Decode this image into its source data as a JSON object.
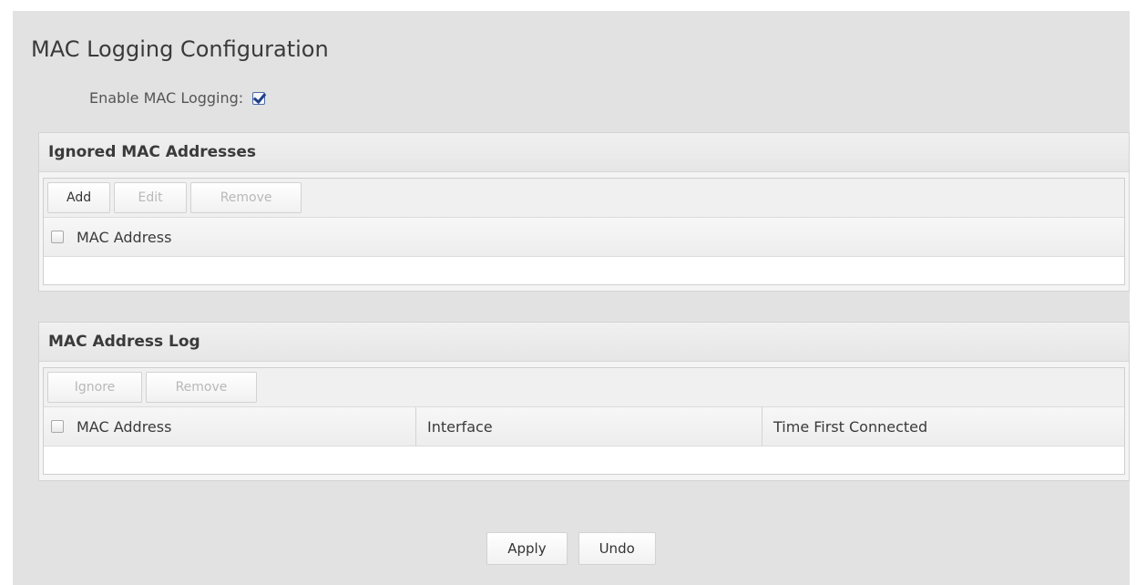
{
  "page": {
    "title": "MAC Logging Configuration",
    "enable_label": "Enable MAC Logging:",
    "enable_checked": true
  },
  "ignored": {
    "title": "Ignored MAC Addresses",
    "toolbar": [
      {
        "label": "Add",
        "enabled": true
      },
      {
        "label": "Edit",
        "enabled": false
      },
      {
        "label": "Remove",
        "enabled": false
      }
    ],
    "columns": [
      "MAC Address"
    ],
    "rows": []
  },
  "log": {
    "title": "MAC Address Log",
    "toolbar": [
      {
        "label": "Ignore",
        "enabled": false
      },
      {
        "label": "Remove",
        "enabled": false
      }
    ],
    "columns": [
      "MAC Address",
      "Interface",
      "Time First Connected"
    ],
    "rows": []
  },
  "footer": {
    "apply_label": "Apply",
    "undo_label": "Undo"
  },
  "colors": {
    "panel_bg": "#e2e2e2",
    "checkbox_check": "#1f3f8a"
  }
}
